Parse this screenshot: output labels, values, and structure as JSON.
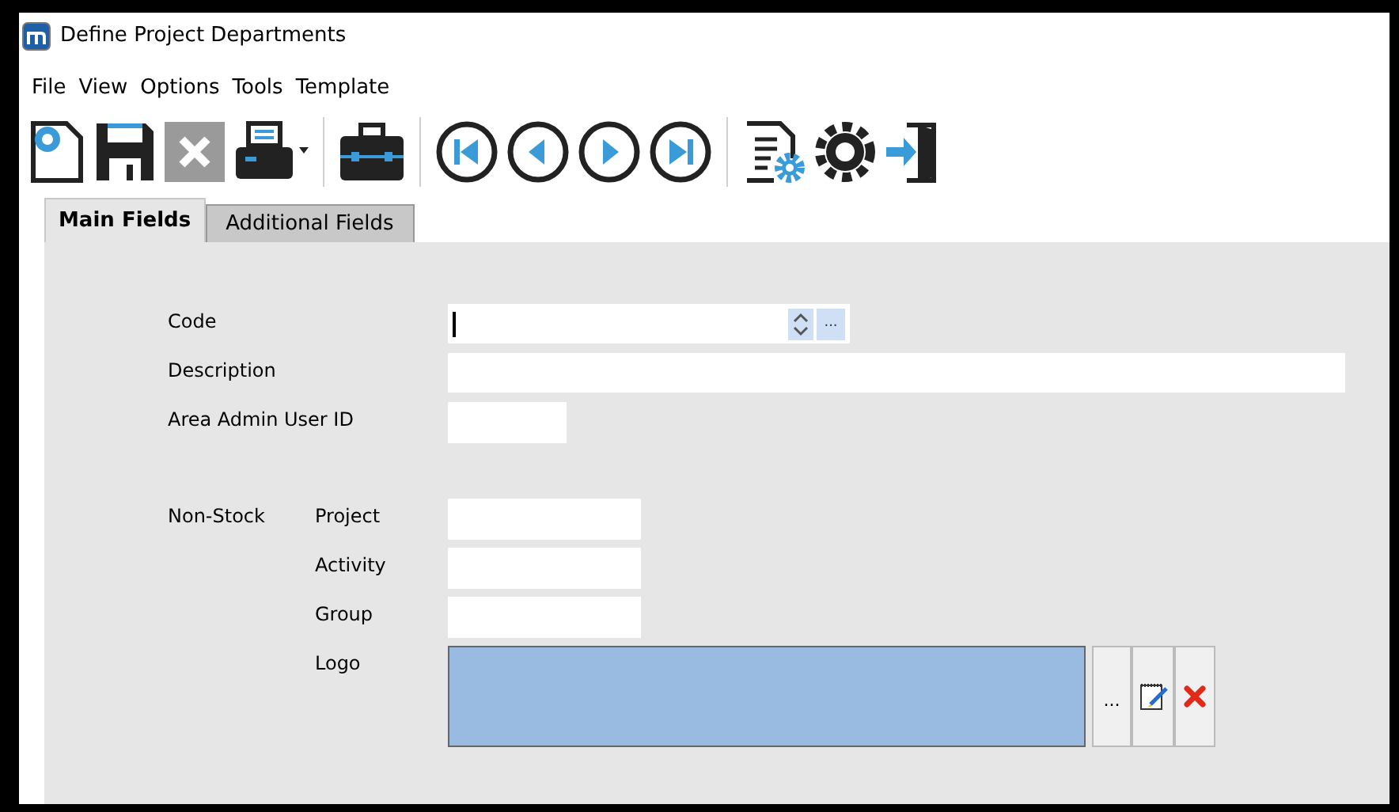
{
  "window": {
    "title": "Define Project Departments"
  },
  "menu": [
    "File",
    "View",
    "Options",
    "Tools",
    "Template"
  ],
  "tabs": [
    {
      "label": "Main Fields",
      "selected": true
    },
    {
      "label": "Additional Fields",
      "selected": false
    }
  ],
  "fields": [
    {
      "label": "Code",
      "kind": "lookup",
      "button": "...",
      "focused": true
    },
    {
      "label": "Description",
      "kind": "wide"
    },
    {
      "label": "Area Admin User ID",
      "kind": "short"
    }
  ],
  "non_stock": {
    "label": "Non-Stock",
    "fields": [
      {
        "label": "Project"
      },
      {
        "label": "Activity"
      },
      {
        "label": "Group"
      }
    ],
    "logo": {
      "label": "Logo",
      "browse_button": "..."
    }
  }
}
